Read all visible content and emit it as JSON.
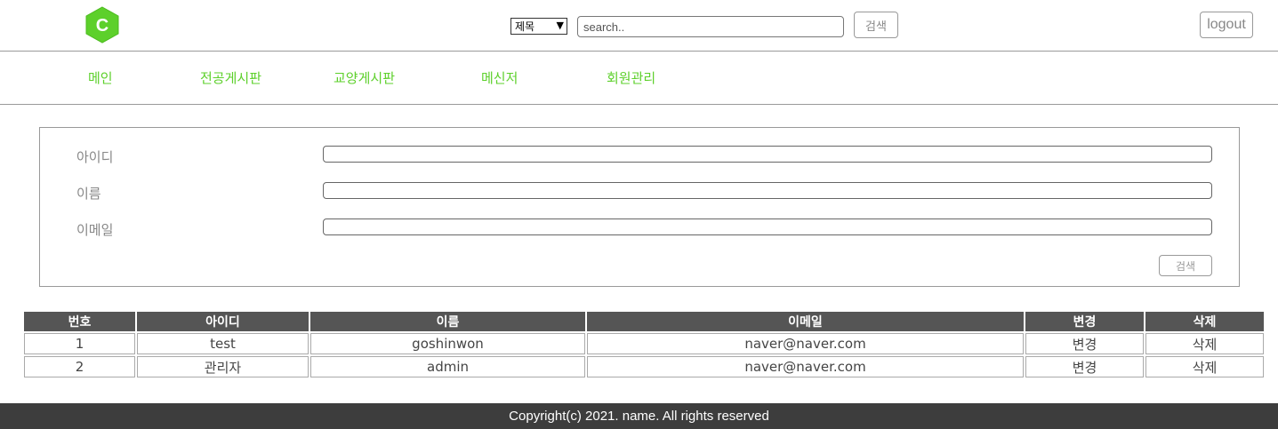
{
  "header": {
    "logo_letter": "C",
    "search_select_value": "제목",
    "search_placeholder": "search..",
    "search_button": "검색",
    "logout_button": "logout"
  },
  "nav": {
    "items": [
      {
        "label": "메인"
      },
      {
        "label": "전공게시판"
      },
      {
        "label": "교양게시판"
      },
      {
        "label": "메신저"
      },
      {
        "label": "회원관리"
      }
    ]
  },
  "search_form": {
    "fields": [
      {
        "label": "아이디",
        "value": ""
      },
      {
        "label": "이름",
        "value": ""
      },
      {
        "label": "이메일",
        "value": ""
      }
    ],
    "search_button": "검색"
  },
  "table": {
    "headers": [
      "번호",
      "아이디",
      "이름",
      "이메일",
      "변경",
      "삭제"
    ],
    "rows": [
      [
        "1",
        "test",
        "goshinwon",
        "naver@naver.com",
        "변경",
        "삭제"
      ],
      [
        "2",
        "관리자",
        "admin",
        "naver@naver.com",
        "변경",
        "삭제"
      ]
    ]
  },
  "footer": {
    "copyright": "Copyright(c) 2021. name. All rights reserved"
  },
  "colors": {
    "logo_green": "#5dd02b",
    "nav_green": "#5dd02b",
    "table_header_bg": "#555555",
    "footer_bg": "#3d3d3d"
  }
}
